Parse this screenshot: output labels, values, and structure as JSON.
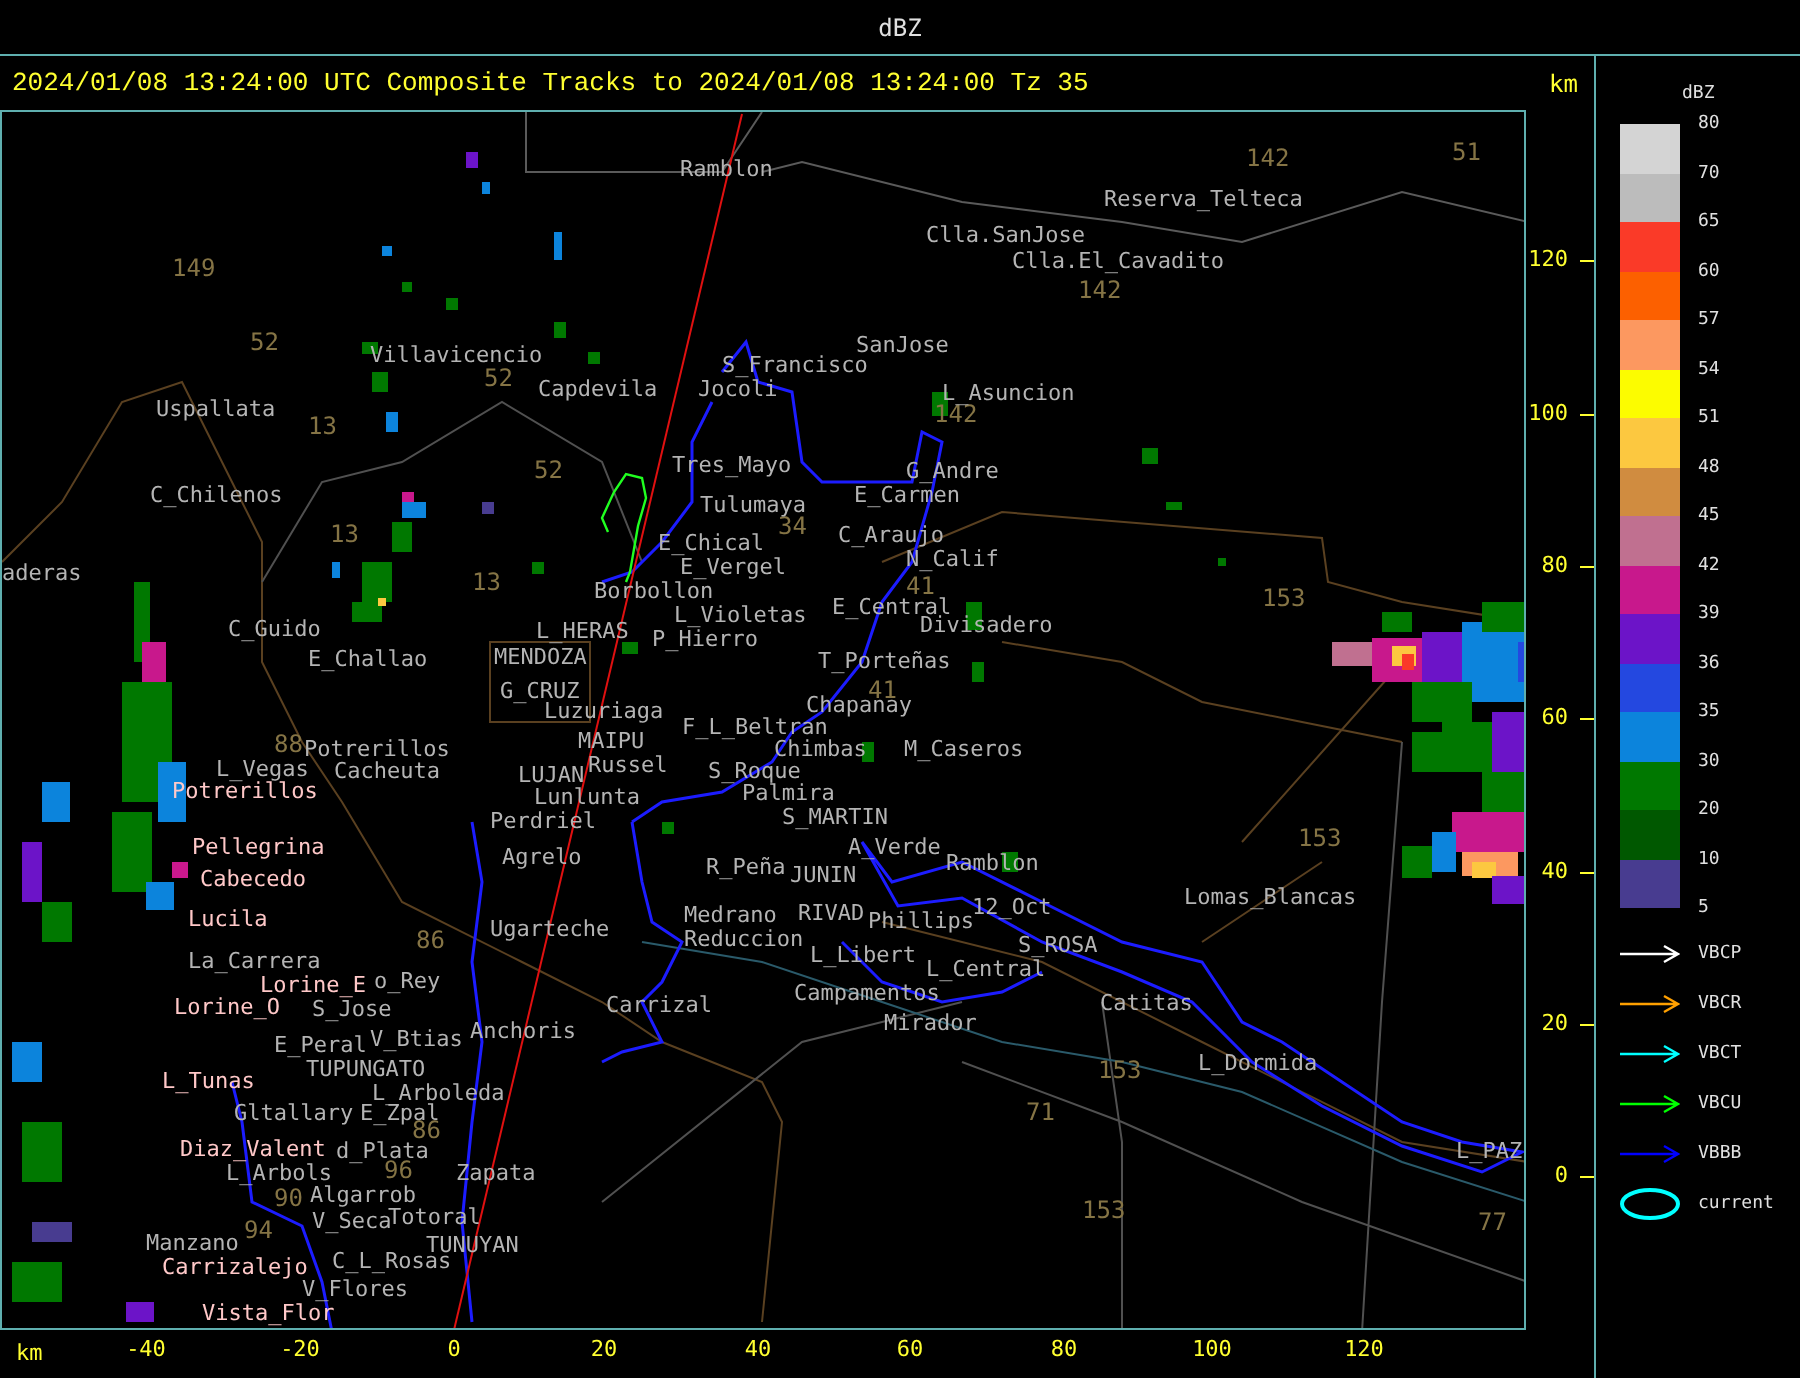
{
  "window": {
    "title": "dBZ"
  },
  "header": {
    "text": "2024/01/08 13:24:00 UTC Composite Tracks to 2024/01/08 13:24:00 Tz 35",
    "unit": "km"
  },
  "map": {
    "places": [
      {
        "name": "Ramblon",
        "color": "#b4b4b4"
      },
      {
        "name": "Reserva_Telteca",
        "color": "#b4b4b4"
      },
      {
        "name": "Clla.SanJose",
        "color": "#b4b4b4"
      },
      {
        "name": "Clla.El_Cavadito",
        "color": "#b4b4b4"
      },
      {
        "name": "Villavicencio",
        "color": "#b4b4b4"
      },
      {
        "name": "SanJose",
        "color": "#b4b4b4"
      },
      {
        "name": "S_Francisco",
        "color": "#b4b4b4"
      },
      {
        "name": "Capdevila",
        "color": "#b4b4b4"
      },
      {
        "name": "Jocoli",
        "color": "#b4b4b4"
      },
      {
        "name": "L_Asuncion",
        "color": "#b4b4b4"
      },
      {
        "name": "Uspallata",
        "color": "#b4b4b4"
      },
      {
        "name": "Tres_Mayo",
        "color": "#b4b4b4"
      },
      {
        "name": "G_Andre",
        "color": "#b4b4b4"
      },
      {
        "name": "C_Chilenos",
        "color": "#b4b4b4"
      },
      {
        "name": "Tulumaya",
        "color": "#b4b4b4"
      },
      {
        "name": "E_Carmen",
        "color": "#b4b4b4"
      },
      {
        "name": "E_Chical",
        "color": "#b4b4b4"
      },
      {
        "name": "C_Araujo",
        "color": "#b4b4b4"
      },
      {
        "name": "N_Calif",
        "color": "#b4b4b4"
      },
      {
        "name": "aderas",
        "color": "#b4b4b4"
      },
      {
        "name": "E_Vergel",
        "color": "#b4b4b4"
      },
      {
        "name": "Borbollon",
        "color": "#b4b4b4"
      },
      {
        "name": "L_Violetas",
        "color": "#b4b4b4"
      },
      {
        "name": "E_Central",
        "color": "#b4b4b4"
      },
      {
        "name": "C_Guido",
        "color": "#b4b4b4"
      },
      {
        "name": "L_HERAS",
        "color": "#b4b4b4"
      },
      {
        "name": "P_Hierro",
        "color": "#b4b4b4"
      },
      {
        "name": "Divisadero",
        "color": "#b4b4b4"
      },
      {
        "name": "E_Challao",
        "color": "#b4b4b4"
      },
      {
        "name": "MENDOZA",
        "color": "#b4b4b4"
      },
      {
        "name": "T_Porteñas",
        "color": "#b4b4b4"
      },
      {
        "name": "G_CRUZ",
        "color": "#b4b4b4"
      },
      {
        "name": "Luzuriaga",
        "color": "#b4b4b4"
      },
      {
        "name": "F_L_Beltran",
        "color": "#b4b4b4"
      },
      {
        "name": "Chapanay",
        "color": "#b4b4b4"
      },
      {
        "name": "Potrerillos",
        "color": "#b4b4b4"
      },
      {
        "name": "MAIPU",
        "color": "#b4b4b4"
      },
      {
        "name": "Chimbas",
        "color": "#b4b4b4"
      },
      {
        "name": "M_Caseros",
        "color": "#b4b4b4"
      },
      {
        "name": "L_Vegas",
        "color": "#b4b4b4"
      },
      {
        "name": "Cacheuta",
        "color": "#b4b4b4"
      },
      {
        "name": "LUJAN",
        "color": "#b4b4b4"
      },
      {
        "name": "Russel",
        "color": "#b4b4b4"
      },
      {
        "name": "S_Roque",
        "color": "#b4b4b4"
      },
      {
        "name": "Potrerillos",
        "color": "#ffc8c8"
      },
      {
        "name": "Lunlunta",
        "color": "#b4b4b4"
      },
      {
        "name": "Palmira",
        "color": "#b4b4b4"
      },
      {
        "name": "Perdriel",
        "color": "#b4b4b4"
      },
      {
        "name": "S_MARTIN",
        "color": "#b4b4b4"
      },
      {
        "name": "Pellegrina",
        "color": "#ffc8c8"
      },
      {
        "name": "Agrelo",
        "color": "#b4b4b4"
      },
      {
        "name": "A_Verde",
        "color": "#b4b4b4"
      },
      {
        "name": "Ramblon",
        "color": "#b4b4b4"
      },
      {
        "name": "Cabecedo",
        "color": "#ffc8c8"
      },
      {
        "name": "R_Peña",
        "color": "#b4b4b4"
      },
      {
        "name": "JUNIN",
        "color": "#b4b4b4"
      },
      {
        "name": "Lucila",
        "color": "#ffc8c8"
      },
      {
        "name": "Medrano",
        "color": "#b4b4b4"
      },
      {
        "name": "RIVAD",
        "color": "#b4b4b4"
      },
      {
        "name": "Phillips",
        "color": "#b4b4b4"
      },
      {
        "name": "12_Oct",
        "color": "#b4b4b4"
      },
      {
        "name": "Lomas_Blancas",
        "color": "#b4b4b4"
      },
      {
        "name": "Ugarteche",
        "color": "#b4b4b4"
      },
      {
        "name": "Reduccion",
        "color": "#b4b4b4"
      },
      {
        "name": "L_Libert",
        "color": "#b4b4b4"
      },
      {
        "name": "S_ROSA",
        "color": "#b4b4b4"
      },
      {
        "name": "La_Carrera",
        "color": "#b4b4b4"
      },
      {
        "name": "L_Central",
        "color": "#b4b4b4"
      },
      {
        "name": "Lorine_E",
        "color": "#ffc8c8"
      },
      {
        "name": "o_Rey",
        "color": "#b4b4b4"
      },
      {
        "name": "Campamentos",
        "color": "#b4b4b4"
      },
      {
        "name": "Lorine_O",
        "color": "#ffc8c8"
      },
      {
        "name": "S_Jose",
        "color": "#b4b4b4"
      },
      {
        "name": "Carrizal",
        "color": "#b4b4b4"
      },
      {
        "name": "Catitas",
        "color": "#b4b4b4"
      },
      {
        "name": "Mirador",
        "color": "#b4b4b4"
      },
      {
        "name": "E_Peral",
        "color": "#b4b4b4"
      },
      {
        "name": "V_Btias",
        "color": "#b4b4b4"
      },
      {
        "name": "Anchoris",
        "color": "#b4b4b4"
      },
      {
        "name": "TUPUNGATO",
        "color": "#b4b4b4"
      },
      {
        "name": "L_Dormida",
        "color": "#b4b4b4"
      },
      {
        "name": "L_Tunas",
        "color": "#ffc8c8"
      },
      {
        "name": "L_Arboleda",
        "color": "#b4b4b4"
      },
      {
        "name": "Gltallary",
        "color": "#b4b4b4"
      },
      {
        "name": "E_Zpal",
        "color": "#b4b4b4"
      },
      {
        "name": "Diaz_Valent",
        "color": "#ffc8c8"
      },
      {
        "name": "d_Plata",
        "color": "#b4b4b4"
      },
      {
        "name": "L_PAZ",
        "color": "#b4b4b4"
      },
      {
        "name": "L_Arbols",
        "color": "#b4b4b4"
      },
      {
        "name": "Zapata",
        "color": "#b4b4b4"
      },
      {
        "name": "Algarrob",
        "color": "#b4b4b4"
      },
      {
        "name": "V_Seca",
        "color": "#b4b4b4"
      },
      {
        "name": "Totoral",
        "color": "#b4b4b4"
      },
      {
        "name": "TUNUYAN",
        "color": "#b4b4b4"
      },
      {
        "name": "Manzano",
        "color": "#b4b4b4"
      },
      {
        "name": "Carrizalejo",
        "color": "#ffc8c8"
      },
      {
        "name": "C_L_Rosas",
        "color": "#b4b4b4"
      },
      {
        "name": "Vista_Flor",
        "color": "#ffc8c8"
      },
      {
        "name": "V_Flores",
        "color": "#b4b4b4"
      }
    ],
    "routes": [
      "149",
      "52",
      "52",
      "13",
      "52",
      "13",
      "13",
      "142",
      "51",
      "142",
      "142",
      "34",
      "41",
      "41",
      "153",
      "153",
      "153",
      "71",
      "153",
      "77",
      "88",
      "86",
      "86",
      "96",
      "90",
      "94"
    ]
  },
  "y_axis": {
    "ticks": [
      "120",
      "100",
      "80",
      "60",
      "40",
      "20",
      "0"
    ]
  },
  "x_axis": {
    "unit": "km",
    "ticks": [
      "-40",
      "-20",
      "0",
      "20",
      "40",
      "60",
      "80",
      "100",
      "120"
    ]
  },
  "legend": {
    "title": "dBZ",
    "bins": [
      {
        "color": "#d4d4d4",
        "label": "80"
      },
      {
        "color": "#bcbcbc",
        "label": "70"
      },
      {
        "color": "#fa3a28",
        "label": "65"
      },
      {
        "color": "#fc6000",
        "label": "60"
      },
      {
        "color": "#fc9860",
        "label": "57"
      },
      {
        "color": "#fcfc00",
        "label": "54"
      },
      {
        "color": "#fcc840",
        "label": "51"
      },
      {
        "color": "#d08c40",
        "label": "48"
      },
      {
        "color": "#c07090",
        "label": "45"
      },
      {
        "color": "#c8188c",
        "label": "42"
      },
      {
        "color": "#6c14c8",
        "label": "39"
      },
      {
        "color": "#2448e0",
        "label": "36"
      },
      {
        "color": "#0c84dc",
        "label": "35"
      },
      {
        "color": "#007800",
        "label": "30"
      },
      {
        "color": "#005800",
        "label": "20"
      },
      {
        "color": "#483c90",
        "label": "10"
      }
    ],
    "last_label": "5",
    "tracks": [
      {
        "kind": "arrow",
        "color": "#ffffff",
        "label": "VBCP"
      },
      {
        "kind": "arrow",
        "color": "#ffa000",
        "label": "VBCR"
      },
      {
        "kind": "arrow",
        "color": "#00ffff",
        "label": "VBCT"
      },
      {
        "kind": "arrow",
        "color": "#00ff00",
        "label": "VBCU"
      },
      {
        "kind": "arrow",
        "color": "#0000ff",
        "label": "VBBB"
      },
      {
        "kind": "ellipse",
        "color": "#00ffff",
        "label": "current"
      }
    ]
  }
}
